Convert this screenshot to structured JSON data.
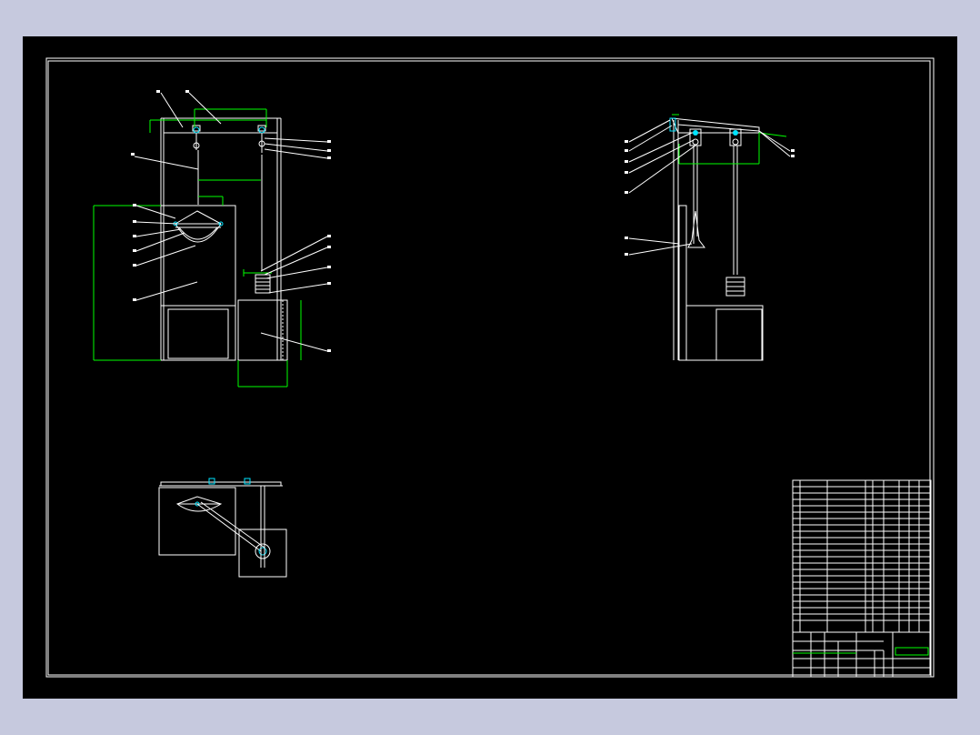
{
  "colors": {
    "window_bg": "#c6c9de",
    "canvas_bg": "#000000",
    "line": "#ffffff",
    "dimension": "#00ff00",
    "accent": "#00e5ff"
  },
  "title_block": {
    "drawing_title": "",
    "header_code": "",
    "header_name": "",
    "header_qty": "",
    "header_material": "",
    "header_weight": "",
    "header_remark": ""
  }
}
